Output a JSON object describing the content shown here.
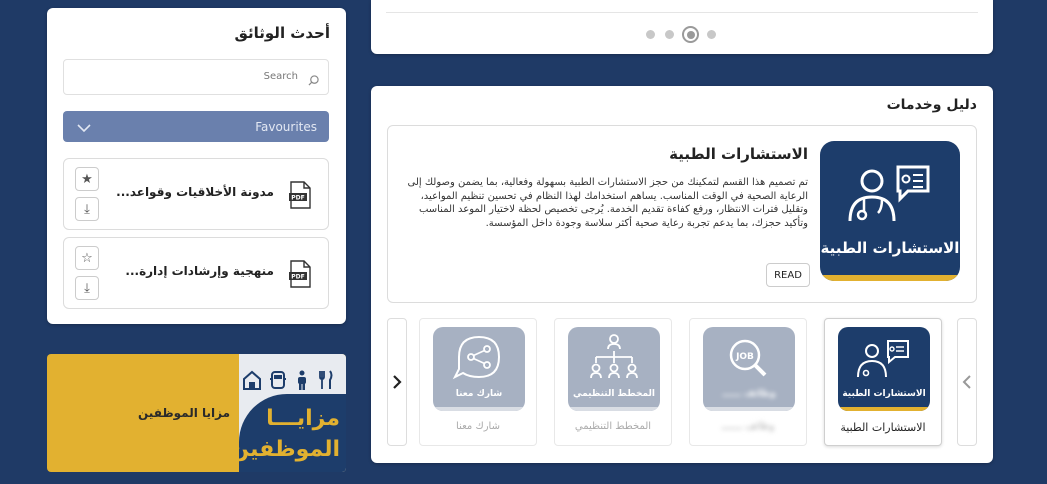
{
  "latest_docs": {
    "title": "أحدث الوثائق",
    "search_placeholder": "Search",
    "favourites_label": "Favourites",
    "items": [
      {
        "name": "مدونة الأخلاقيات وقواعد...",
        "star": "★",
        "download": "⤓"
      },
      {
        "name": "منهجية وإرشادات إدارة...",
        "star": "☆",
        "download": "⤓"
      }
    ]
  },
  "benefits": {
    "label": "مزايا الموظفين",
    "title_line1": "مزايـــا",
    "title_line2": "الموظفين"
  },
  "services": {
    "title": "دليل وخدمات",
    "feature": {
      "title": "الاستشارات الطبية",
      "icon_caption": "الاستشارات الطبية",
      "description": "تم تصميم هذا القسم لتمكينك من حجز الاستشارات الطبية بسهولة وفعالية، بما يضمن وصولك إلى الرعاية الصحية في الوقت المناسب. يساهم استخدامك لهذا النظام في تحسين تنظيم المواعيد، وتقليل فترات الانتظار، ورفع كفاءة تقديم الخدمة. يُرجى تخصيص لحظة لاختيار الموعد المناسب وتأكيد حجزك، بما يدعم تجربة رعاية صحية أكثر سلاسة وجودة داخل المؤسسة.",
      "read_label": "READ"
    },
    "tiles": [
      {
        "caption": "الاستشارات الطبية",
        "label": "الاستشارات الطبية"
      },
      {
        "caption": "وظائف ــــــ",
        "label": "وظائف ـــــــ"
      },
      {
        "caption": "المخطط التنظيمي",
        "label": "المخطط التنظيمي"
      },
      {
        "caption": "شارك معنا",
        "label": "شارك معنا"
      }
    ]
  },
  "colors": {
    "background": "#1f3a66",
    "navy": "#1d3d6b",
    "gold": "#e2b130",
    "favourites_bar": "#6a80ad"
  },
  "icons": [
    "search-icon",
    "chevron-down-icon",
    "pdf-icon",
    "star-icon",
    "download-icon",
    "doctor-chat-icon",
    "job-search-icon",
    "org-chart-icon",
    "share-chat-icon",
    "chevron-left-icon",
    "chevron-right-icon"
  ]
}
